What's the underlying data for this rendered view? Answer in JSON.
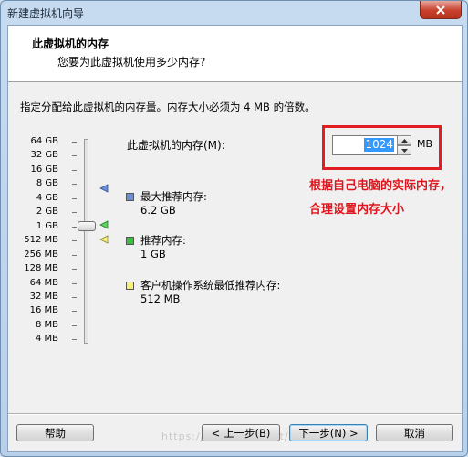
{
  "window": {
    "title": "新建虚拟机向导"
  },
  "header": {
    "title": "此虚拟机的内存",
    "subtitle": "您要为此虚拟机使用多少内存?"
  },
  "description": "指定分配给此虚拟机的内存量。内存大小必须为 4 MB 的倍数。",
  "memory_field": {
    "label": "此虚拟机的内存(M):",
    "value": "1024",
    "unit": "MB"
  },
  "scale_labels": [
    "64 GB",
    "32 GB",
    "16 GB",
    "8 GB",
    "4 GB",
    "2 GB",
    "1 GB",
    "512 MB",
    "256 MB",
    "128 MB",
    "64 MB",
    "32 MB",
    "16 MB",
    "8 MB",
    "4 MB"
  ],
  "slider": {
    "selected": "1 GB"
  },
  "legend": [
    {
      "title": "最大推荐内存:",
      "value": "6.2 GB",
      "color": "#6b8fd6"
    },
    {
      "title": "推荐内存:",
      "value": "1 GB",
      "color": "#36c23a"
    },
    {
      "title": "客户机操作系统最低推荐内存:",
      "value": "512 MB",
      "color": "#f5f078"
    }
  ],
  "annotation": {
    "text": "根据自己电脑的实际内存，合理设置内存大小",
    "color": "#e21e24"
  },
  "buttons": {
    "help": "帮助",
    "back": "< 上一步(B)",
    "next": "下一步(N) >",
    "cancel": "取消"
  },
  "watermark": "https://blog.csdn.net/"
}
